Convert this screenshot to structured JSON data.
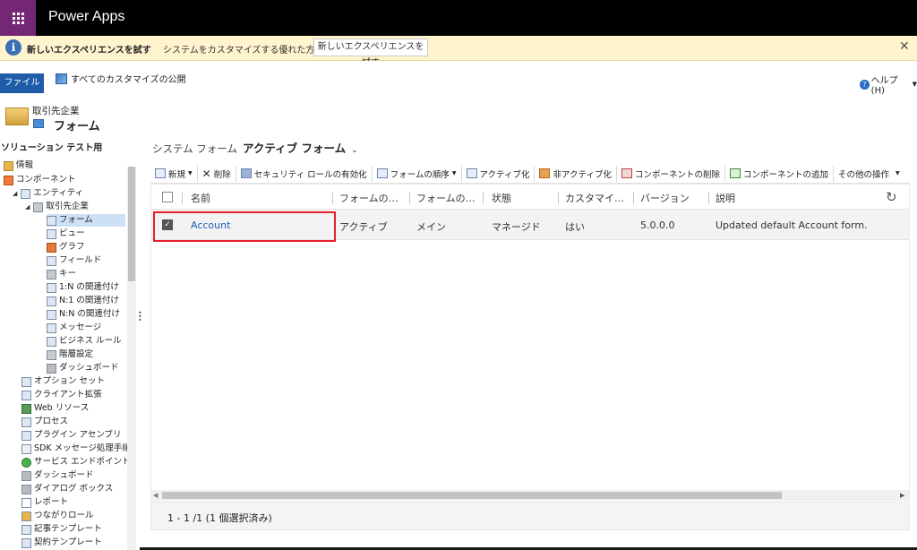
{
  "app": {
    "title": "Power Apps"
  },
  "banner": {
    "title": "新しいエクスペリエンスを試す",
    "message": "システムをカスタマイズする優れた方法があります",
    "button": "新しいエクスペリエンスを試す",
    "close": "✕"
  },
  "ribbon": {
    "file_tab": "ファイル",
    "publish_all": "すべてのカスタマイズの公開",
    "help": "ヘルプ(H)"
  },
  "sidebar": {
    "entity": "取引先企業",
    "form": "フォーム",
    "solution": "ソリューション テスト用",
    "tree": [
      {
        "label": "情報",
        "icon": "info-tree-icon"
      },
      {
        "label": "コンポーネント",
        "icon": "components-icon"
      },
      {
        "label": "エンティティ",
        "icon": "entities-icon"
      },
      {
        "label": "取引先企業",
        "icon": "entity-icon"
      },
      {
        "label": "フォーム",
        "icon": "form-icon",
        "selected": true
      },
      {
        "label": "ビュー",
        "icon": "view-icon"
      },
      {
        "label": "グラフ",
        "icon": "chart-icon"
      },
      {
        "label": "フィールド",
        "icon": "field-icon"
      },
      {
        "label": "キー",
        "icon": "key-icon"
      },
      {
        "label": "1:N の関連付け",
        "icon": "relationship-icon"
      },
      {
        "label": "N:1 の関連付け",
        "icon": "relationship-icon"
      },
      {
        "label": "N:N の関連付け",
        "icon": "relationship-icon"
      },
      {
        "label": "メッセージ",
        "icon": "message-icon"
      },
      {
        "label": "ビジネス ルール",
        "icon": "business-rule-icon"
      },
      {
        "label": "階層設定",
        "icon": "hierarchy-icon"
      },
      {
        "label": "ダッシュボード",
        "icon": "dashboard-icon"
      },
      {
        "label": "オプション セット",
        "icon": "option-set-icon"
      },
      {
        "label": "クライアント拡張",
        "icon": "client-extension-icon"
      },
      {
        "label": "Web リソース",
        "icon": "web-resource-icon"
      },
      {
        "label": "プロセス",
        "icon": "process-icon"
      },
      {
        "label": "プラグイン アセンブリ",
        "icon": "plugin-icon"
      },
      {
        "label": "SDK メッセージ処理手順",
        "icon": "sdk-icon"
      },
      {
        "label": "サービス エンドポイント",
        "icon": "service-endpoint-icon"
      },
      {
        "label": "ダッシュボード",
        "icon": "dashboard-icon"
      },
      {
        "label": "ダイアログ ボックス",
        "icon": "dialog-icon"
      },
      {
        "label": "レポート",
        "icon": "report-icon"
      },
      {
        "label": "つながりロール",
        "icon": "connection-role-icon"
      },
      {
        "label": "記事テンプレート",
        "icon": "article-template-icon"
      },
      {
        "label": "契約テンプレート",
        "icon": "contract-template-icon"
      }
    ]
  },
  "main": {
    "system_label": "システム フォーム",
    "view_name": "アクティブ フォーム",
    "toolbar": [
      {
        "label": "新規",
        "icon": "new-icon",
        "dropdown": true
      },
      {
        "label": "削除",
        "icon": "delete-icon"
      },
      {
        "label": "セキュリティ ロールの有効化",
        "icon": "security-role-icon"
      },
      {
        "label": "フォームの順序",
        "icon": "form-order-icon",
        "dropdown": true
      },
      {
        "label": "アクティブ化",
        "icon": "activate-icon"
      },
      {
        "label": "非アクティブ化",
        "icon": "deactivate-icon"
      },
      {
        "label": "コンポーネントの削除",
        "icon": "remove-component-icon"
      },
      {
        "label": "コンポーネントの追加",
        "icon": "add-component-icon"
      },
      {
        "label": "その他の操作",
        "icon": "",
        "dropdown": true
      }
    ],
    "columns": [
      "名前",
      "フォームの…",
      "フォームの…",
      "状態",
      "カスタマイ…",
      "バージョン",
      "説明"
    ],
    "rows": [
      [
        "Account",
        "アクティブ",
        "メイン",
        "マネージド",
        "はい",
        "5.0.0.0",
        "Updated default Account form."
      ]
    ],
    "footer": "1 - 1 /1 (1 個選択済み)"
  }
}
